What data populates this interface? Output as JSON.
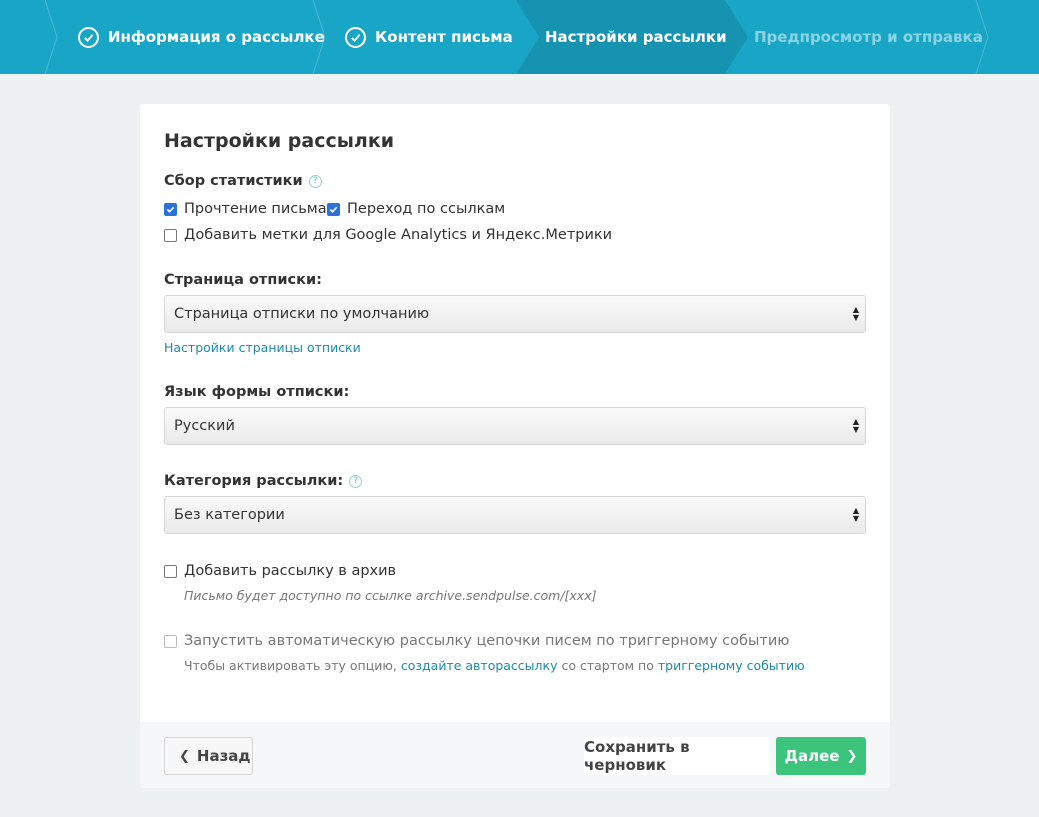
{
  "stepper": {
    "steps": [
      {
        "label": "Информация о рассылке",
        "state": "done"
      },
      {
        "label": "Контент письма",
        "state": "done"
      },
      {
        "label": "Настройки рассылки",
        "state": "active"
      },
      {
        "label": "Предпросмотр и отправка",
        "state": "upcoming"
      }
    ]
  },
  "page": {
    "title": "Настройки рассылки"
  },
  "stats": {
    "label": "Сбор статистики",
    "help": "?",
    "read_label": "Прочтение письма",
    "read_checked": true,
    "clicks_label": "Переход по ссылкам",
    "clicks_checked": true,
    "utm_label": "Добавить метки для Google Analytics и Яндекс.Метрики",
    "utm_checked": false
  },
  "unsubscribe": {
    "label": "Страница отписки:",
    "selected": "Страница отписки по умолчанию",
    "settings_link": "Настройки страницы отписки"
  },
  "language": {
    "label": "Язык формы отписки:",
    "selected": "Русский"
  },
  "category": {
    "label": "Категория рассылки:",
    "help": "?",
    "selected": "Без категории"
  },
  "archive": {
    "label": "Добавить рассылку в архив",
    "checked": false,
    "hint": "Письмо будет доступно по ссылке archive.sendpulse.com/[xxx]"
  },
  "automation": {
    "label": "Запустить автоматическую рассылку цепочки писем по триггерному событию",
    "checked": false,
    "hint_prefix": "Чтобы активировать эту опцию,",
    "hint_link1": "создайте авторассылку",
    "hint_middle": "со стартом по",
    "hint_link2": "триггерному событию"
  },
  "footer": {
    "back_label": "Назад",
    "draft_label": "Сохранить в черновик",
    "next_label": "Далее"
  },
  "colors": {
    "stepper_bg": "#19a5c5",
    "stepper_active": "#1693b0",
    "link": "#1c8aa6",
    "next_button": "#3cc47c",
    "checkbox": "#2a72d8"
  }
}
